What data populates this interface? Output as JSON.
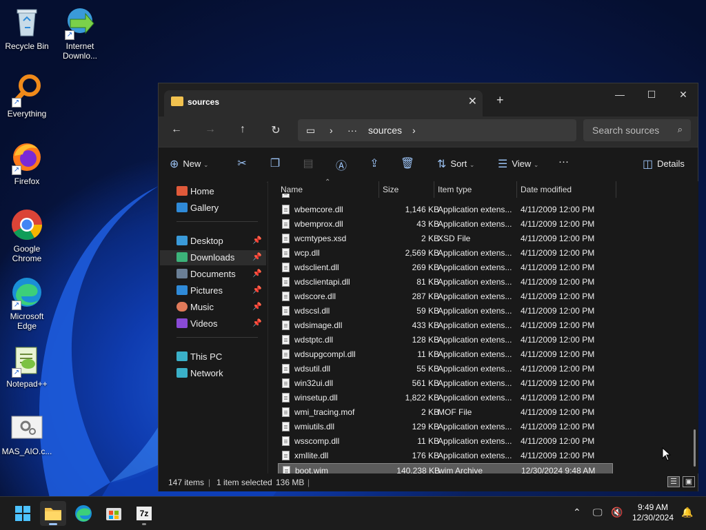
{
  "desktop": {
    "icons": [
      {
        "label": "Recycle Bin"
      },
      {
        "label": "Internet Downlo..."
      },
      {
        "label": "Everything"
      },
      {
        "label": "Firefox"
      },
      {
        "label": "Google Chrome"
      },
      {
        "label": "Microsoft Edge"
      },
      {
        "label": "Notepad++"
      },
      {
        "label": "MAS_AIO.c..."
      }
    ]
  },
  "window": {
    "tab_title": "sources",
    "address_crumb": "sources",
    "address_ellipsis": "···",
    "search_placeholder": "Search sources",
    "toolbar": {
      "new_label": "New",
      "sort_label": "Sort",
      "view_label": "View",
      "more_label": "···",
      "details_label": "Details"
    },
    "sidebar": {
      "home": "Home",
      "gallery": "Gallery",
      "desktop": "Desktop",
      "downloads": "Downloads",
      "documents": "Documents",
      "pictures": "Pictures",
      "music": "Music",
      "videos": "Videos",
      "this_pc": "This PC",
      "network": "Network"
    },
    "columns": {
      "name": "Name",
      "size": "Size",
      "type": "Item type",
      "date": "Date modified"
    },
    "files": [
      {
        "name": "wbemcore.dll",
        "size": "1,146 KB",
        "type": "Application extens...",
        "date": "4/11/2009 12:00 PM"
      },
      {
        "name": "wbemprox.dll",
        "size": "43 KB",
        "type": "Application extens...",
        "date": "4/11/2009 12:00 PM"
      },
      {
        "name": "wcmtypes.xsd",
        "size": "2 KB",
        "type": "XSD File",
        "date": "4/11/2009 12:00 PM"
      },
      {
        "name": "wcp.dll",
        "size": "2,569 KB",
        "type": "Application extens...",
        "date": "4/11/2009 12:00 PM"
      },
      {
        "name": "wdsclient.dll",
        "size": "269 KB",
        "type": "Application extens...",
        "date": "4/11/2009 12:00 PM"
      },
      {
        "name": "wdsclientapi.dll",
        "size": "81 KB",
        "type": "Application extens...",
        "date": "4/11/2009 12:00 PM"
      },
      {
        "name": "wdscore.dll",
        "size": "287 KB",
        "type": "Application extens...",
        "date": "4/11/2009 12:00 PM"
      },
      {
        "name": "wdscsl.dll",
        "size": "59 KB",
        "type": "Application extens...",
        "date": "4/11/2009 12:00 PM"
      },
      {
        "name": "wdsimage.dll",
        "size": "433 KB",
        "type": "Application extens...",
        "date": "4/11/2009 12:00 PM"
      },
      {
        "name": "wdstptc.dll",
        "size": "128 KB",
        "type": "Application extens...",
        "date": "4/11/2009 12:00 PM"
      },
      {
        "name": "wdsupgcompl.dll",
        "size": "11 KB",
        "type": "Application extens...",
        "date": "4/11/2009 12:00 PM"
      },
      {
        "name": "wdsutil.dll",
        "size": "55 KB",
        "type": "Application extens...",
        "date": "4/11/2009 12:00 PM"
      },
      {
        "name": "win32ui.dll",
        "size": "561 KB",
        "type": "Application extens...",
        "date": "4/11/2009 12:00 PM"
      },
      {
        "name": "winsetup.dll",
        "size": "1,822 KB",
        "type": "Application extens...",
        "date": "4/11/2009 12:00 PM"
      },
      {
        "name": "wmi_tracing.mof",
        "size": "2 KB",
        "type": "MOF File",
        "date": "4/11/2009 12:00 PM"
      },
      {
        "name": "wmiutils.dll",
        "size": "129 KB",
        "type": "Application extens...",
        "date": "4/11/2009 12:00 PM"
      },
      {
        "name": "wsscomp.dll",
        "size": "11 KB",
        "type": "Application extens...",
        "date": "4/11/2009 12:00 PM"
      },
      {
        "name": "xmllite.dll",
        "size": "176 KB",
        "type": "Application extens...",
        "date": "4/11/2009 12:00 PM"
      },
      {
        "name": "boot.wim",
        "size": "140,238 KB",
        "type": "wim Archive",
        "date": "12/30/2024 9:48 AM"
      }
    ],
    "status": {
      "item_count": "147 items",
      "selection": "1 item selected",
      "selection_size": "136 MB"
    }
  },
  "taskbar": {
    "time": "9:49 AM",
    "date": "12/30/2024",
    "sevenzip_label": "7z"
  }
}
